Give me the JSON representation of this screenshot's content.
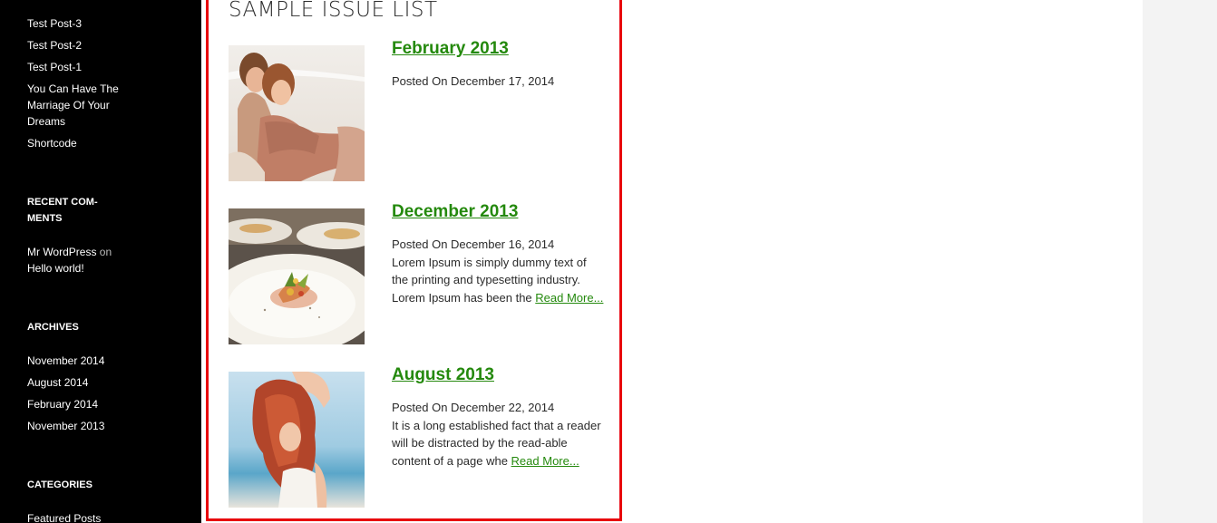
{
  "sidebar": {
    "posts": [
      {
        "label": "Test Post-3"
      },
      {
        "label": "Test Post-2"
      },
      {
        "label": "Test Post-1"
      },
      {
        "label": "You Can Have The Marriage Of Your Dreams"
      },
      {
        "label": "Shortcode"
      }
    ],
    "recent_comments_heading": "RECENT COM-MENTS",
    "recent_comment": {
      "author": "Mr WordPress",
      "connector": " on ",
      "post": "Hello world!"
    },
    "archives_heading": "ARCHIVES",
    "archives": [
      {
        "label": "November 2014"
      },
      {
        "label": "August 2014"
      },
      {
        "label": "February 2014"
      },
      {
        "label": "November 2013"
      }
    ],
    "categories_heading": "CATEGORIES",
    "categories": [
      {
        "label": "Featured Posts"
      }
    ]
  },
  "main": {
    "title": "SAMPLE ISSUE LIST",
    "issues": [
      {
        "title": "February 2013",
        "date": "Posted On December 17, 2014",
        "excerpt": "",
        "read_more": "",
        "image": "couple-on-beach-photo"
      },
      {
        "title": "December 2013",
        "date": "Posted On December 16, 2014",
        "excerpt": "Lorem Ipsum is simply dummy text of the printing and typesetting industry. Lorem Ipsum has been the ",
        "read_more": "Read More...",
        "image": "plated-food-photo"
      },
      {
        "title": "August 2013",
        "date": "Posted On December 22, 2014",
        "excerpt": "It is a long established fact that a reader will be distracted by the read-able content of a page whe ",
        "read_more": "Read More...",
        "image": "woman-red-hair-beach-photo"
      }
    ]
  },
  "colors": {
    "sidebar_bg": "#000000",
    "link_green": "#24890d",
    "highlight_border": "#e8000b",
    "right_gutter": "#f3f3f3"
  }
}
